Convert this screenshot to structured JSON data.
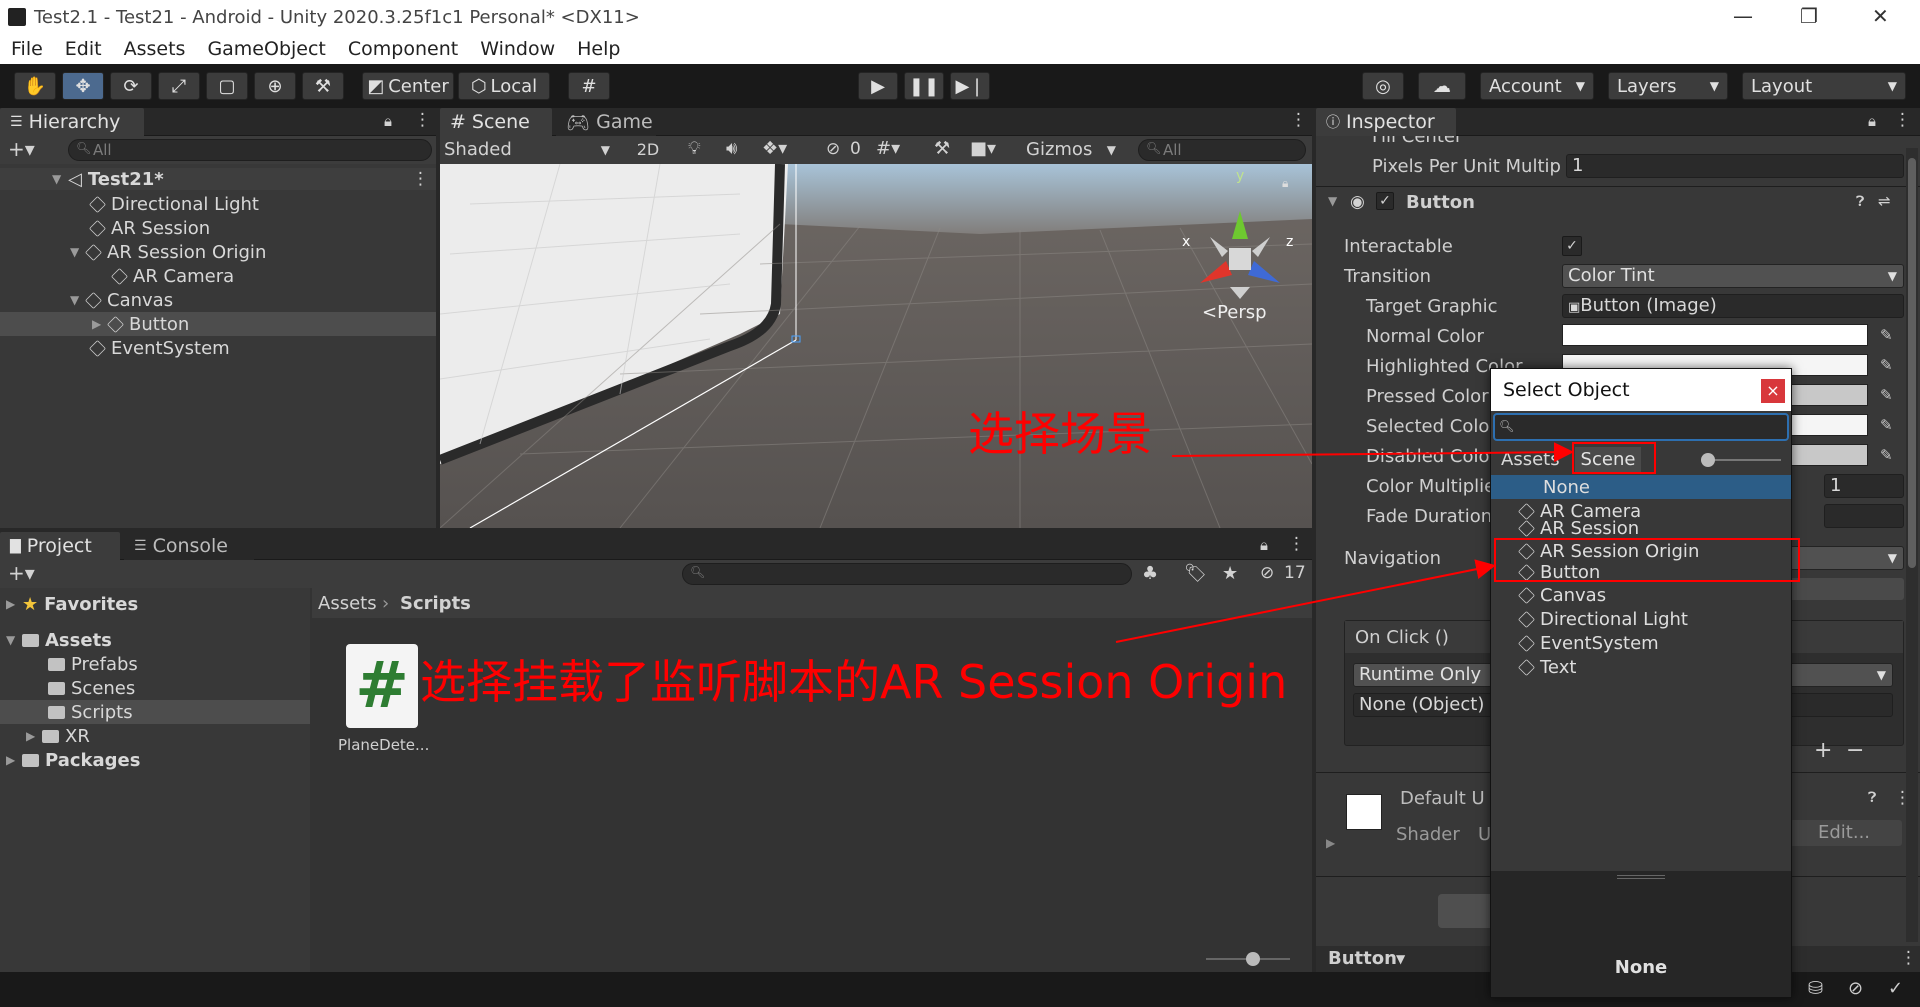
{
  "window": {
    "title": "Test2.1 - Test21 - Android - Unity 2020.3.25f1c1 Personal* <DX11>"
  },
  "menu": [
    "File",
    "Edit",
    "Assets",
    "GameObject",
    "Component",
    "Window",
    "Help"
  ],
  "toolbar": {
    "center": "Center",
    "local": "Local",
    "account": "Account",
    "layers": "Layers",
    "layout": "Layout"
  },
  "hierarchy": {
    "tab": "Hierarchy",
    "search_placeholder": "All",
    "scene": "Test21*",
    "items": [
      "Directional Light",
      "AR Session",
      "AR Session Origin",
      "AR Camera",
      "Canvas",
      "Button",
      "EventSystem"
    ]
  },
  "scene": {
    "tab_scene": "Scene",
    "tab_game": "Game",
    "shading": "Shaded",
    "mode2d": "2D",
    "hidden_count": "0",
    "gizmos": "Gizmos",
    "search_placeholder": "All",
    "persp": "Persp",
    "axis_x": "x",
    "axis_y": "y",
    "axis_z": "z"
  },
  "project": {
    "tab_project": "Project",
    "tab_console": "Console",
    "hidden_count": "17",
    "favorites": "Favorites",
    "assets": "Assets",
    "folders": [
      "Prefabs",
      "Scenes",
      "Scripts",
      "XR"
    ],
    "packages": "Packages",
    "breadcrumb": [
      "Assets",
      "Scripts"
    ],
    "file": "PlaneDete...",
    "file_glyph": "#"
  },
  "inspector": {
    "tab": "Inspector",
    "clipped_label": "Fill Center",
    "pixels_label": "Pixels Per Unit Multip",
    "pixels_value": "1",
    "component": "Button",
    "interactable": "Interactable",
    "transition": "Transition",
    "transition_value": "Color Tint",
    "target_graphic": "Target Graphic",
    "target_graphic_value": "Button (Image)",
    "normal_color": "Normal Color",
    "highlighted_color": "Highlighted Color",
    "pressed_color": "Pressed Color",
    "selected_color": "Selected Colo",
    "disabled_color": "Disabled Colo",
    "color_multiplier": "Color Multiplie",
    "color_multiplier_value": "1",
    "fade_duration": "Fade Duration",
    "navigation": "Navigation",
    "onclick": "On Click ()",
    "runtime": "Runtime Only",
    "none_object": "None (Object)",
    "material": "Default U",
    "shader_label": "Shader",
    "shader_value": "U",
    "edit": "Edit...",
    "footer": "Button"
  },
  "popup": {
    "title": "Select Object",
    "close": "×",
    "tab_assets": "Assets",
    "tab_scene": "Scene",
    "items": [
      "None",
      "AR Camera",
      "AR Session",
      "AR Session Origin",
      "Button",
      "Canvas",
      "Directional Light",
      "EventSystem",
      "Text"
    ],
    "preview": "None"
  },
  "annotations": {
    "select_scene": "选择场景",
    "select_origin": "选择挂载了监听脚本的AR Session Origin"
  },
  "colors": {
    "accent": "#4c6a8f",
    "selection": "#2c5d87",
    "annotation": "#ff0000"
  }
}
